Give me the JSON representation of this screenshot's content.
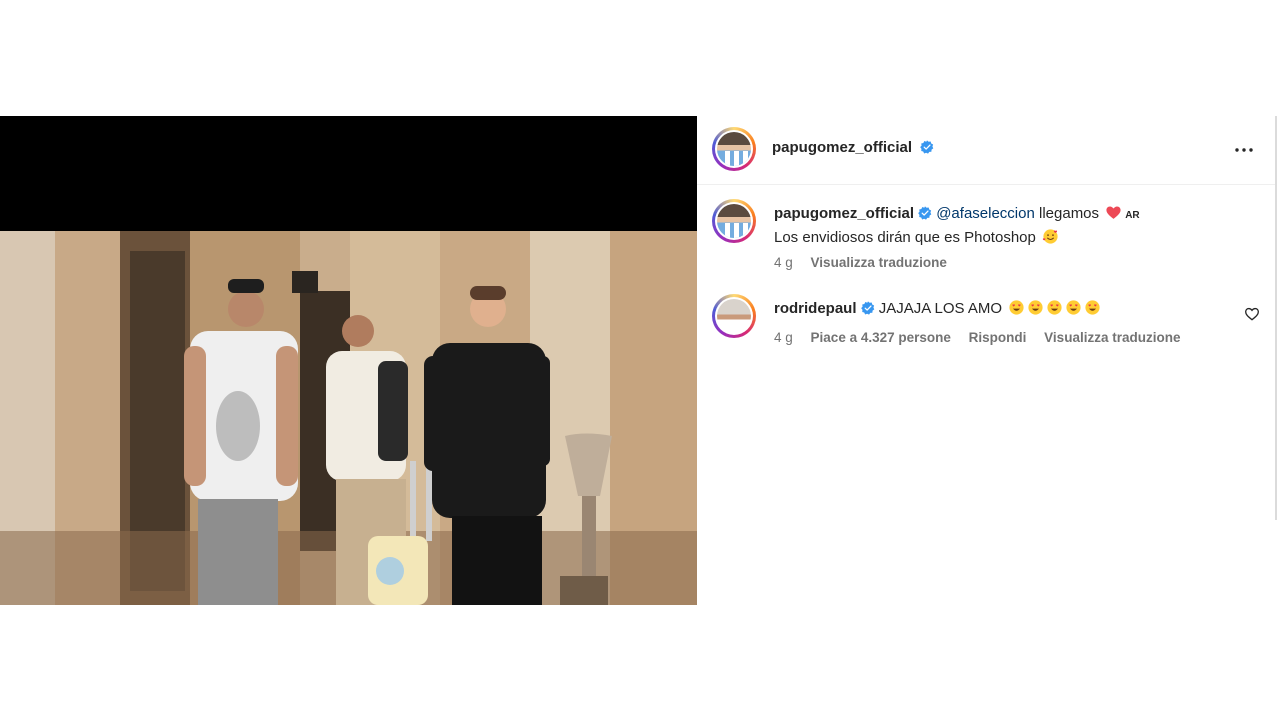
{
  "post": {
    "author": {
      "username": "papugomez_official",
      "verified": true,
      "avatar_icon": "profile-avatar"
    },
    "more_icon": "more-horizontal-icon",
    "photo": {
      "description_icon": "post-photo"
    }
  },
  "caption": {
    "username": "papugomez_official",
    "mention": "@afaseleccion",
    "text_line1": "llegamos",
    "heart_emoji": "red-heart",
    "flag_badge": "AR",
    "text_line2": "Los envidiosos dirán que es Photoshop",
    "line2_emoji": "smiling-face-with-hearts",
    "age": "4 g",
    "translate_label": "Visualizza traduzione"
  },
  "comments": [
    {
      "username": "rodridepaul",
      "verified": true,
      "text": "JAJAJA LOS AMO",
      "emoji": "heart-eyes",
      "emoji_count": 5,
      "age": "4 g",
      "likes_label": "Piace a 4.327 persone",
      "reply_label": "Rispondi",
      "translate_label": "Visualizza traduzione",
      "like_icon": "heart-outline-icon"
    }
  ],
  "colors": {
    "accent_link": "#00376b",
    "verified_blue": "#3897f0",
    "meta_gray": "#737373",
    "heart_red": "#ed4956"
  }
}
